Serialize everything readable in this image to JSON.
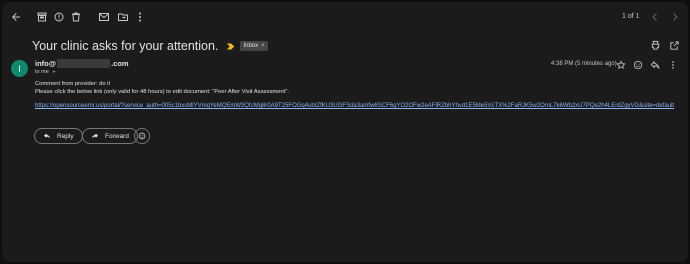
{
  "pager": {
    "text": "1 of 1"
  },
  "subject": "Your clinic asks for your attention.",
  "label": {
    "name": "Inbox",
    "remove": "×"
  },
  "sender": {
    "initial": "I",
    "prefix": "info@",
    "suffix": ".com"
  },
  "recipient": {
    "text": "to me"
  },
  "timestamp": "4:38 PM (5 minutes ago)",
  "body": {
    "line1": "Comment from provider: do it",
    "line2": "Please click the below link (only valid for 48 hours) to edit document: \"Peer After Visit Assessment\".",
    "link": "https://opensourceemr.us/portal/?service_auth=005c1bxsMlYVmqYeMQEmW3QfcMg8r0A9T25FOGq4ubtZfKU3UGFSda3amfw6SCF6gYO2OFw2eAFlRZbhYhvd1E5Me5VcTX%2FaRJK5w2OmL7k6Wb2xU7PQe2h4LErdZgyVG&site=default"
  },
  "actions": {
    "reply": "Reply",
    "forward": "Forward"
  },
  "colors": {
    "background": "#1b1b1b",
    "link": "#8ab4f8",
    "avatar": "#0f8a6d",
    "important": "#f6b81a"
  }
}
